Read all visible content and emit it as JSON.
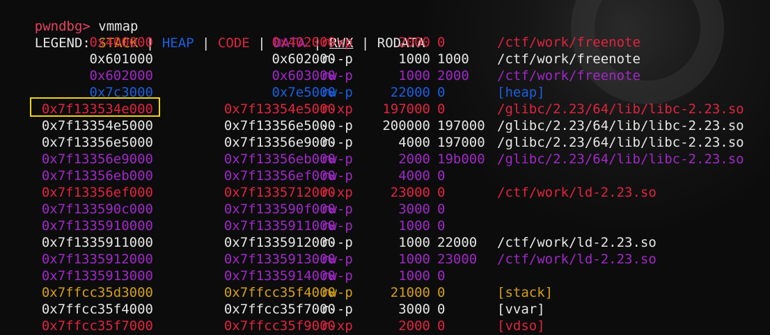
{
  "colors": {
    "prompt": "#e8415f",
    "default": "#e6e6e6",
    "stack": "#d4a017",
    "heap": "#1a5fe0",
    "code": "#e0243e",
    "data": "#a028c8",
    "rwx": "#e6e6e6",
    "rodata": "#e6e6e6",
    "highlight_box": "#f1d60b"
  },
  "prompt": {
    "name": "pwndbg>",
    "command": " vmmap"
  },
  "legend": {
    "label": "LEGEND: ",
    "items": [
      {
        "text": "STACK",
        "kind": "stack"
      },
      {
        "text": "HEAP",
        "kind": "heap"
      },
      {
        "text": "CODE",
        "kind": "code"
      },
      {
        "text": "DATA",
        "kind": "data"
      },
      {
        "text": "RWX",
        "kind": "rwx"
      },
      {
        "text": "RODATA",
        "kind": "rodata"
      }
    ],
    "separator": " | "
  },
  "mappings": [
    {
      "start": "0x400000",
      "end": "0x402000",
      "perm": "r-xp",
      "size": "2000",
      "offset": "0",
      "path": "/ctf/work/freenote",
      "kind": "code"
    },
    {
      "start": "0x601000",
      "end": "0x602000",
      "perm": "r--p",
      "size": "1000",
      "offset": "1000",
      "path": "/ctf/work/freenote",
      "kind": "default"
    },
    {
      "start": "0x602000",
      "end": "0x603000",
      "perm": "rw-p",
      "size": "1000",
      "offset": "2000",
      "path": "/ctf/work/freenote",
      "kind": "data"
    },
    {
      "start": "0x7c3000",
      "end": "0x7e5000",
      "perm": "rw-p",
      "size": "22000",
      "offset": "0",
      "path": "[heap]",
      "kind": "heap"
    },
    {
      "start": "0x7f133534e000",
      "end": "0x7f13354e5000",
      "perm": "r-xp",
      "size": "197000",
      "offset": "0",
      "path": "/glibc/2.23/64/lib/libc-2.23.so",
      "kind": "code"
    },
    {
      "start": "0x7f13354e5000",
      "end": "0x7f13356e5000",
      "perm": "---p",
      "size": "200000",
      "offset": "197000",
      "path": "/glibc/2.23/64/lib/libc-2.23.so",
      "kind": "default"
    },
    {
      "start": "0x7f13356e5000",
      "end": "0x7f13356e9000",
      "perm": "r--p",
      "size": "4000",
      "offset": "197000",
      "path": "/glibc/2.23/64/lib/libc-2.23.so",
      "kind": "default"
    },
    {
      "start": "0x7f13356e9000",
      "end": "0x7f13356eb000",
      "perm": "rw-p",
      "size": "2000",
      "offset": "19b000",
      "path": "/glibc/2.23/64/lib/libc-2.23.so",
      "kind": "data"
    },
    {
      "start": "0x7f13356eb000",
      "end": "0x7f13356ef000",
      "perm": "rw-p",
      "size": "4000",
      "offset": "0",
      "path": "",
      "kind": "data"
    },
    {
      "start": "0x7f13356ef000",
      "end": "0x7f1335712000",
      "perm": "r-xp",
      "size": "23000",
      "offset": "0",
      "path": "/ctf/work/ld-2.23.so",
      "kind": "code"
    },
    {
      "start": "0x7f133590c000",
      "end": "0x7f133590f000",
      "perm": "rw-p",
      "size": "3000",
      "offset": "0",
      "path": "",
      "kind": "data"
    },
    {
      "start": "0x7f1335910000",
      "end": "0x7f1335911000",
      "perm": "rw-p",
      "size": "1000",
      "offset": "0",
      "path": "",
      "kind": "data"
    },
    {
      "start": "0x7f1335911000",
      "end": "0x7f1335912000",
      "perm": "r--p",
      "size": "1000",
      "offset": "22000",
      "path": "/ctf/work/ld-2.23.so",
      "kind": "default"
    },
    {
      "start": "0x7f1335912000",
      "end": "0x7f1335913000",
      "perm": "rw-p",
      "size": "1000",
      "offset": "23000",
      "path": "/ctf/work/ld-2.23.so",
      "kind": "data"
    },
    {
      "start": "0x7f1335913000",
      "end": "0x7f1335914000",
      "perm": "rw-p",
      "size": "1000",
      "offset": "0",
      "path": "",
      "kind": "data"
    },
    {
      "start": "0x7ffcc35d3000",
      "end": "0x7ffcc35f4000",
      "perm": "rw-p",
      "size": "21000",
      "offset": "0",
      "path": "[stack]",
      "kind": "stack"
    },
    {
      "start": "0x7ffcc35f4000",
      "end": "0x7ffcc35f7000",
      "perm": "r--p",
      "size": "3000",
      "offset": "0",
      "path": "[vvar]",
      "kind": "default"
    },
    {
      "start": "0x7ffcc35f7000",
      "end": "0x7ffcc35f9000",
      "perm": "r-xp",
      "size": "2000",
      "offset": "0",
      "path": "[vdso]",
      "kind": "code"
    }
  ],
  "highlighted_row": 4
}
